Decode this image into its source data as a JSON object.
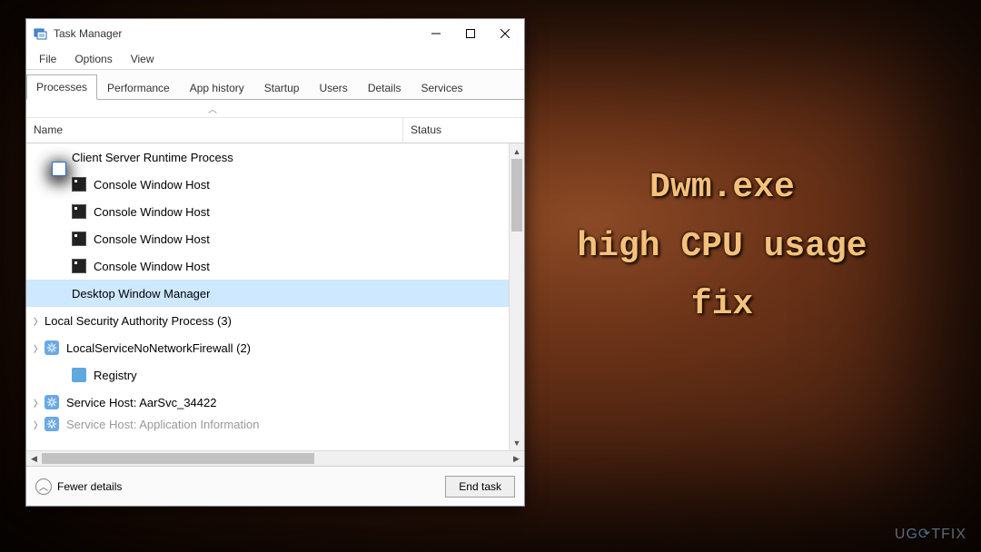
{
  "window": {
    "title": "Task Manager",
    "menus": [
      "File",
      "Options",
      "View"
    ],
    "tabs": [
      "Processes",
      "Performance",
      "App history",
      "Startup",
      "Users",
      "Details",
      "Services"
    ],
    "active_tab_index": 0,
    "columns": {
      "name": "Name",
      "status": "Status"
    },
    "fewer_details": "Fewer details",
    "end_task": "End task"
  },
  "processes": [
    {
      "name": "Client Server Runtime Process",
      "icon": "window",
      "child": true,
      "selected": false
    },
    {
      "name": "Console Window Host",
      "icon": "console",
      "child": true,
      "selected": false
    },
    {
      "name": "Console Window Host",
      "icon": "console",
      "child": true,
      "selected": false
    },
    {
      "name": "Console Window Host",
      "icon": "console",
      "child": true,
      "selected": false
    },
    {
      "name": "Console Window Host",
      "icon": "console",
      "child": true,
      "selected": false
    },
    {
      "name": "Desktop Window Manager",
      "icon": "window",
      "child": true,
      "selected": true
    },
    {
      "name": "Local Security Authority Process (3)",
      "icon": "window",
      "child": false,
      "expandable": true,
      "selected": false
    },
    {
      "name": "LocalServiceNoNetworkFirewall (2)",
      "icon": "gear",
      "child": false,
      "expandable": true,
      "selected": false
    },
    {
      "name": "Registry",
      "icon": "registry",
      "child": true,
      "selected": false
    },
    {
      "name": "Service Host: AarSvc_34422",
      "icon": "gear",
      "child": false,
      "expandable": true,
      "selected": false
    }
  ],
  "headline": {
    "line1": "Dwm.exe",
    "line2": "high CPU usage",
    "line3": "fix"
  },
  "watermark": "UG⟳TFIX"
}
